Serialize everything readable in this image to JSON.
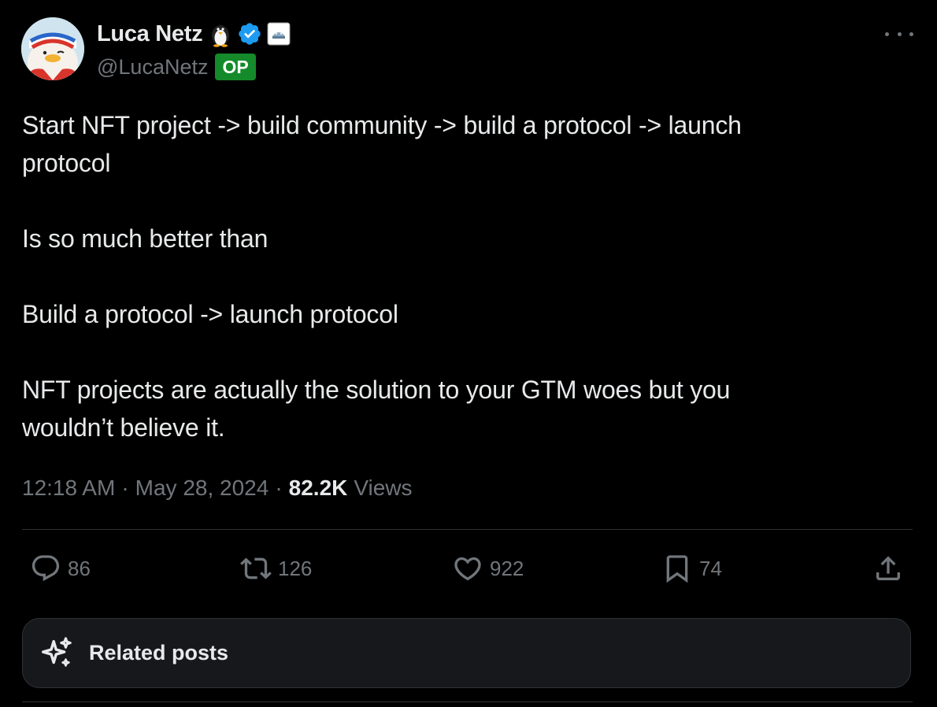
{
  "author": {
    "display_name": "Luca Netz",
    "handle": "@LucaNetz",
    "op_badge": "OP"
  },
  "tweet": {
    "text": "Start NFT project -> build community -> build a protocol -> launch\nprotocol\n\nIs so much better than\n\nBuild a protocol -> launch protocol\n\nNFT projects are actually the solution to your GTM woes but you\nwouldn’t believe it.",
    "time": "12:18 AM",
    "date": "May 28, 2024",
    "views_count": "82.2K",
    "views_label": "Views"
  },
  "actions": {
    "replies": "86",
    "reposts": "126",
    "likes": "922",
    "bookmarks": "74"
  },
  "related": {
    "label": "Related posts"
  },
  "colors": {
    "background": "#000000",
    "text_primary": "#e7e9ea",
    "text_secondary": "#71767b",
    "verified_blue": "#1d9bf0",
    "op_green": "#148a2a",
    "divider": "#2f3336"
  },
  "icons": [
    "avatar-penguin",
    "penguin-emoji-icon",
    "verified-badge-icon",
    "affiliate-badge-icon",
    "more-icon",
    "reply-icon",
    "repost-icon",
    "like-icon",
    "bookmark-icon",
    "share-icon",
    "sparkle-icon"
  ]
}
